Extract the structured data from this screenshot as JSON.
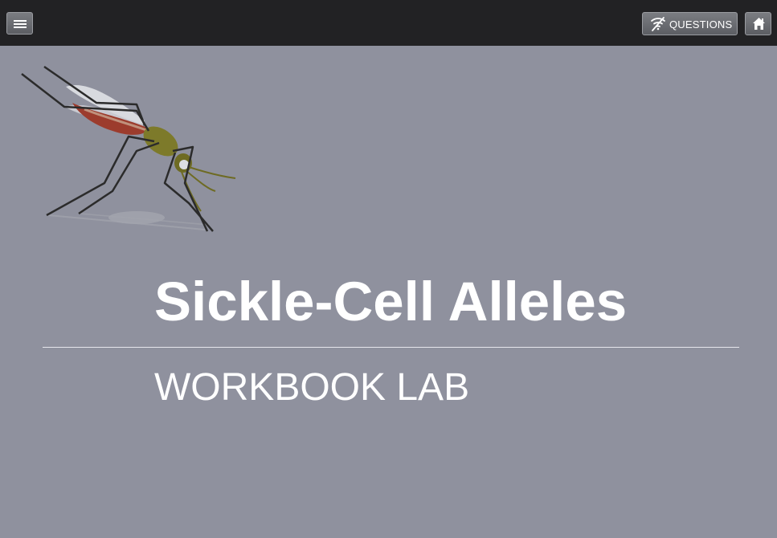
{
  "header": {
    "questions_label": "QUESTIONS",
    "menu_icon": "hamburger-menu-icon",
    "questions_icon": "questions-off-icon",
    "home_icon": "home-icon"
  },
  "main": {
    "title": "Sickle-Cell Alleles",
    "subtitle": "WORKBOOK LAB",
    "illustration": "mosquito-illustration"
  },
  "colors": {
    "background": "#8f919e",
    "topbar": "#222224",
    "text": "#ffffff"
  }
}
